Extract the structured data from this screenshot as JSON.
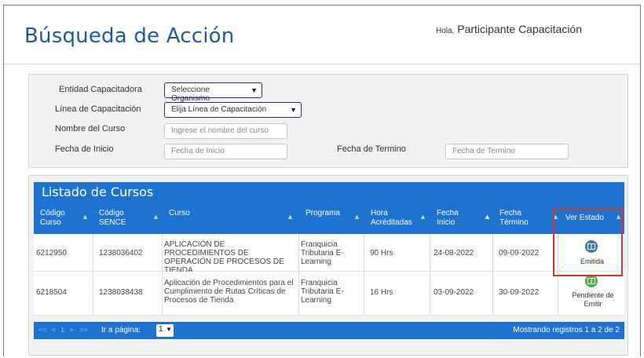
{
  "page": {
    "title": "Búsqueda de Acción",
    "greeting_prefix": "Hola,",
    "user_name": "Participante Capacitación"
  },
  "filters": {
    "entidad": {
      "label": "Entidad Capacitadora",
      "value": "Seleccione Organismo"
    },
    "linea": {
      "label": "Línea de Capacitación",
      "value": "Elija Línea de Capacitación"
    },
    "nombre": {
      "label": "Nombre del Curso",
      "placeholder": "Ingrese el nombre del curso"
    },
    "fecha_inicio": {
      "label": "Fecha de Inicio",
      "placeholder": "Fecha de Inicio"
    },
    "fecha_termino": {
      "label": "Fecha de Termino",
      "placeholder": "Fecha de Termino"
    }
  },
  "listing": {
    "title": "Listado de Cursos",
    "columns": [
      {
        "label": "Código Curso"
      },
      {
        "label": "Código SENCE"
      },
      {
        "label": "Curso"
      },
      {
        "label": "Programa"
      },
      {
        "label": "Hora Acréditadas"
      },
      {
        "label": "Fecha Inicio"
      },
      {
        "label": "Fecha Término"
      },
      {
        "label": "Ver Estado"
      }
    ],
    "rows": [
      {
        "codigo_curso": "6212950",
        "codigo_sence": "1238036402",
        "curso": "APLICACIÓN DE PROCEDIMIENTOS DE OPERACIÓN DE PROCESOS DE TIENDA",
        "programa": "Franquicia Tributaria E-Learning",
        "horas": "90 Hrs",
        "fecha_inicio": "24-08-2022",
        "fecha_termino": "09-09-2022",
        "estado": "Emitida",
        "estado_icon": "certificate-icon",
        "estado_color": "#3a7ca6"
      },
      {
        "codigo_curso": "6218504",
        "codigo_sence": "1238038438",
        "curso": "Aplicación de Procedimientos para el Cumplimiento de Rutas Críticas de Procesos de Tienda",
        "programa": "Franquicia Tributaria E-Learning",
        "horas": "16 Hrs",
        "fecha_inicio": "03-09-2022",
        "fecha_termino": "30-09-2022",
        "estado": "Pendiente de Emitir",
        "estado_icon": "certificate-icon",
        "estado_color": "#4cae4c"
      }
    ],
    "pager": {
      "first": "<<",
      "prev": "<",
      "page": "1",
      "next": ">",
      "last": ">>",
      "goto_label": "Ir a página:",
      "selected_page": "1",
      "records_info": "Mostrando registros 1 a 2 de 2"
    }
  },
  "colors": {
    "accent": "#1e73d0",
    "title": "#1e5aa0",
    "highlight": "#d9342b"
  }
}
